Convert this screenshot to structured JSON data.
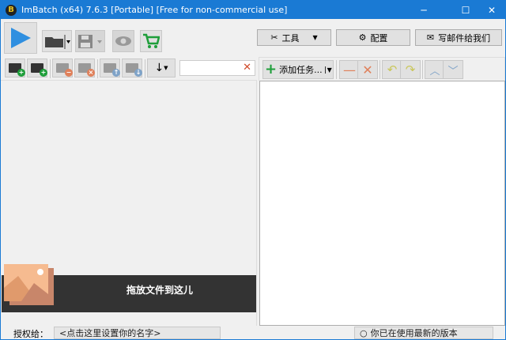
{
  "title": {
    "logo": "B",
    "text": "ImBatch (x64) 7.6.3 [Portable] [Free for non-commercial use]"
  },
  "window_controls": {
    "minimize": "─",
    "maximize": "☐",
    "close": "✕"
  },
  "toolbar": {
    "tools_label": "工具",
    "settings_label": "配置",
    "email_label": "写邮件给我们"
  },
  "left_toolbar": {
    "search_value": "",
    "clear": "✕",
    "sort": "↓"
  },
  "task_toolbar": {
    "add_task_label": "添加任务..."
  },
  "drop_zone": {
    "text": "拖放文件到这儿"
  },
  "statusbar": {
    "license_label": "授权给：",
    "license_value": "<点击这里设置你的名字>",
    "update_status": "你已在使用最新的版本"
  },
  "colors": {
    "accent": "#1a7ad4",
    "play": "#2f8fe0",
    "cart": "#1e9e3a",
    "add": "#1e9e3a",
    "remove": "#e0805a"
  }
}
